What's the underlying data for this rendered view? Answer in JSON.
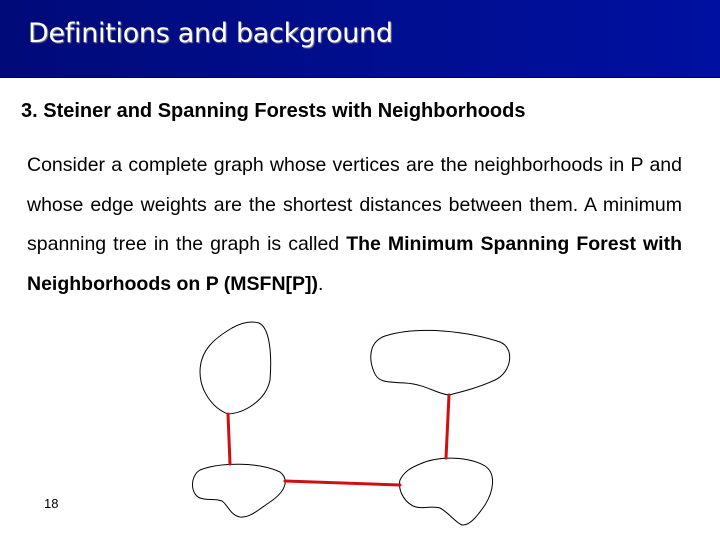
{
  "slide": {
    "title": "Definitions and background",
    "subtitle": "3. Steiner and Spanning Forests with Neighborhoods",
    "body_plain": "Consider a complete graph whose vertices are the neighborhoods in P and whose edge weights are the shortest distances between them. A minimum spanning tree in the graph is called ",
    "body_bold": "The Minimum Spanning Forest with Neighborhoods on P (MSFN[P])",
    "body_end": ".",
    "page_number": "18"
  },
  "diagram": {
    "neighborhoods": [
      "top-left",
      "top-right",
      "bottom-left",
      "bottom-right"
    ],
    "edges": [
      {
        "from": "top-left",
        "to": "bottom-left"
      },
      {
        "from": "bottom-left",
        "to": "bottom-right"
      },
      {
        "from": "top-right",
        "to": "bottom-right"
      }
    ],
    "colors": {
      "outline": "#000000",
      "edge": "#d01010"
    }
  },
  "colors": {
    "header_bg": "#000e8e",
    "header_text": "#ffffff"
  }
}
